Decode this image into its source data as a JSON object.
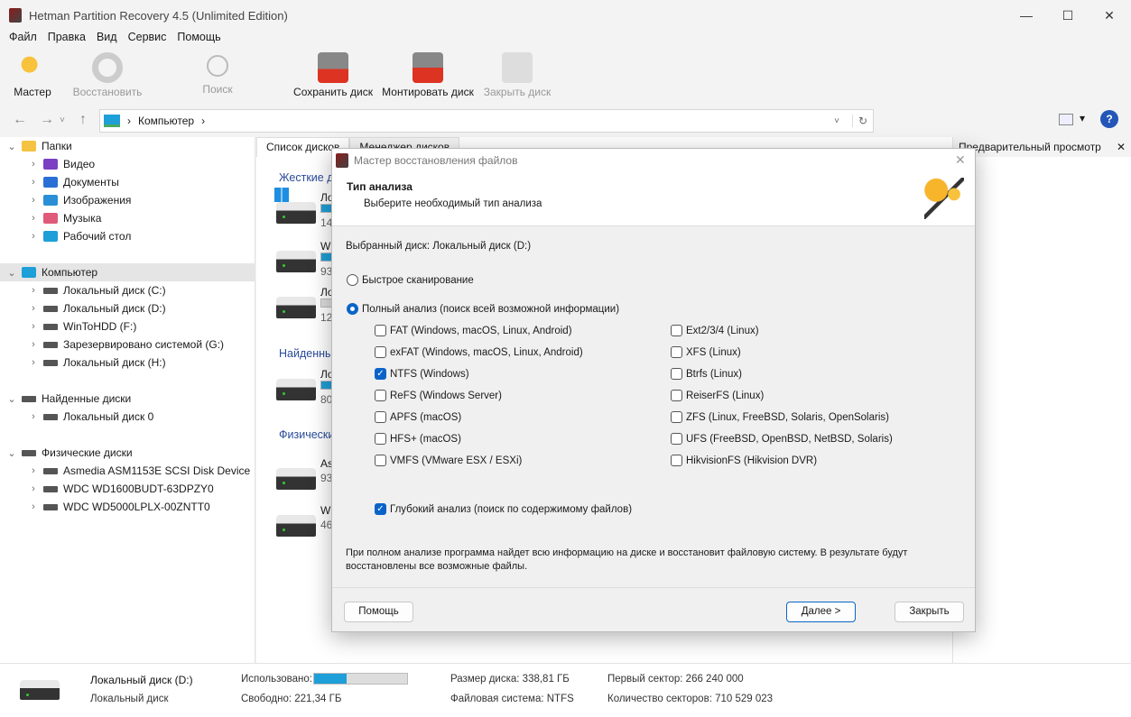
{
  "window": {
    "title": "Hetman Partition Recovery 4.5 (Unlimited Edition)",
    "minimize": "—",
    "maximize": "☐",
    "close": "✕"
  },
  "menu": [
    "Файл",
    "Правка",
    "Вид",
    "Сервис",
    "Помощь"
  ],
  "toolbar": {
    "wizard": "Мастер",
    "restore": "Восстановить",
    "search": "Поиск",
    "save_disk": "Сохранить диск",
    "mount_disk": "Монтировать диск",
    "close_disk": "Закрыть диск"
  },
  "address": {
    "path": "Компьютер",
    "sep": "›",
    "back": "←",
    "forward": "→",
    "dropdown": "˅",
    "up": "↑",
    "refresh": "↻",
    "view": "▾",
    "help": "?"
  },
  "tree": {
    "folders": {
      "label": "Папки",
      "items": [
        "Видео",
        "Документы",
        "Изображения",
        "Музыка",
        "Рабочий стол"
      ]
    },
    "computer": {
      "label": "Компьютер",
      "items": [
        "Локальный диск (C:)",
        "Локальный диск (D:)",
        "WinToHDD (F:)",
        "Зарезервировано системой (G:)",
        "Локальный диск (H:)"
      ]
    },
    "found": {
      "label": "Найденные диски",
      "items": [
        "Локальный диск 0"
      ]
    },
    "physical": {
      "label": "Физические диски",
      "items": [
        "Asmedia ASM1153E SCSI Disk Device",
        "WDC WD1600BUDT-63DPZY0",
        "WDC WD5000LPLX-00ZNTT0"
      ]
    }
  },
  "tabs": [
    "Список дисков",
    "Менеджер дисков"
  ],
  "disk_list": {
    "groups": [
      "Жесткие д",
      "Найденны",
      "Физически"
    ],
    "items": [
      {
        "name": "Ло",
        "size": "14"
      },
      {
        "name": "W",
        "size": "93"
      },
      {
        "name": "Ло",
        "size": "12"
      },
      {
        "name": "Ло",
        "size": "80"
      },
      {
        "name": "As",
        "size": "93"
      },
      {
        "name": "W",
        "size": "46"
      }
    ]
  },
  "preview": {
    "title": "Предварительный просмотр",
    "close": "✕"
  },
  "dialog": {
    "title": "Мастер восстановления файлов",
    "close": "✕",
    "heading": "Тип анализа",
    "subheading": "Выберите необходимый тип анализа",
    "selected_disk": "Выбранный диск: Локальный диск (D:)",
    "quick": "Быстрое сканирование",
    "full": "Полный анализ (поиск всей возможной информации)",
    "fs_left": [
      {
        "label": "FAT (Windows, macOS, Linux, Android)",
        "checked": false
      },
      {
        "label": "exFAT (Windows, macOS, Linux, Android)",
        "checked": false
      },
      {
        "label": "NTFS (Windows)",
        "checked": true
      },
      {
        "label": "ReFS (Windows Server)",
        "checked": false
      },
      {
        "label": "APFS (macOS)",
        "checked": false
      },
      {
        "label": "HFS+ (macOS)",
        "checked": false
      },
      {
        "label": "VMFS (VMware ESX / ESXi)",
        "checked": false
      }
    ],
    "fs_right": [
      {
        "label": "Ext2/3/4 (Linux)",
        "checked": false
      },
      {
        "label": "XFS (Linux)",
        "checked": false
      },
      {
        "label": "Btrfs (Linux)",
        "checked": false
      },
      {
        "label": "ReiserFS (Linux)",
        "checked": false
      },
      {
        "label": "ZFS (Linux, FreeBSD, Solaris, OpenSolaris)",
        "checked": false
      },
      {
        "label": "UFS (FreeBSD, OpenBSD, NetBSD, Solaris)",
        "checked": false
      },
      {
        "label": "HikvisionFS (Hikvision DVR)",
        "checked": false
      }
    ],
    "deep": "Глубокий анализ (поиск по содержимому файлов)",
    "description": "При полном анализе программа найдет всю информацию на диске и восстановит файловую систему. В результате будут восстановлены все возможные файлы.",
    "help_btn": "Помощь",
    "next_btn": "Далее >",
    "close_btn": "Закрыть"
  },
  "status": {
    "name": "Локальный диск (D:)",
    "type": "Локальный диск",
    "used_label": "Использовано:",
    "used_fraction": 0.35,
    "free": "Свободно: 221,34 ГБ",
    "size": "Размер диска: 338,81 ГБ",
    "fs": "Файловая система: NTFS",
    "first_sector": "Первый сектор: 266 240 000",
    "sector_count": "Количество секторов: 710 529 023"
  },
  "colors": {
    "accent": "#0a64c8",
    "bar": "#1e9fd8",
    "group": "#2a4a9a"
  }
}
